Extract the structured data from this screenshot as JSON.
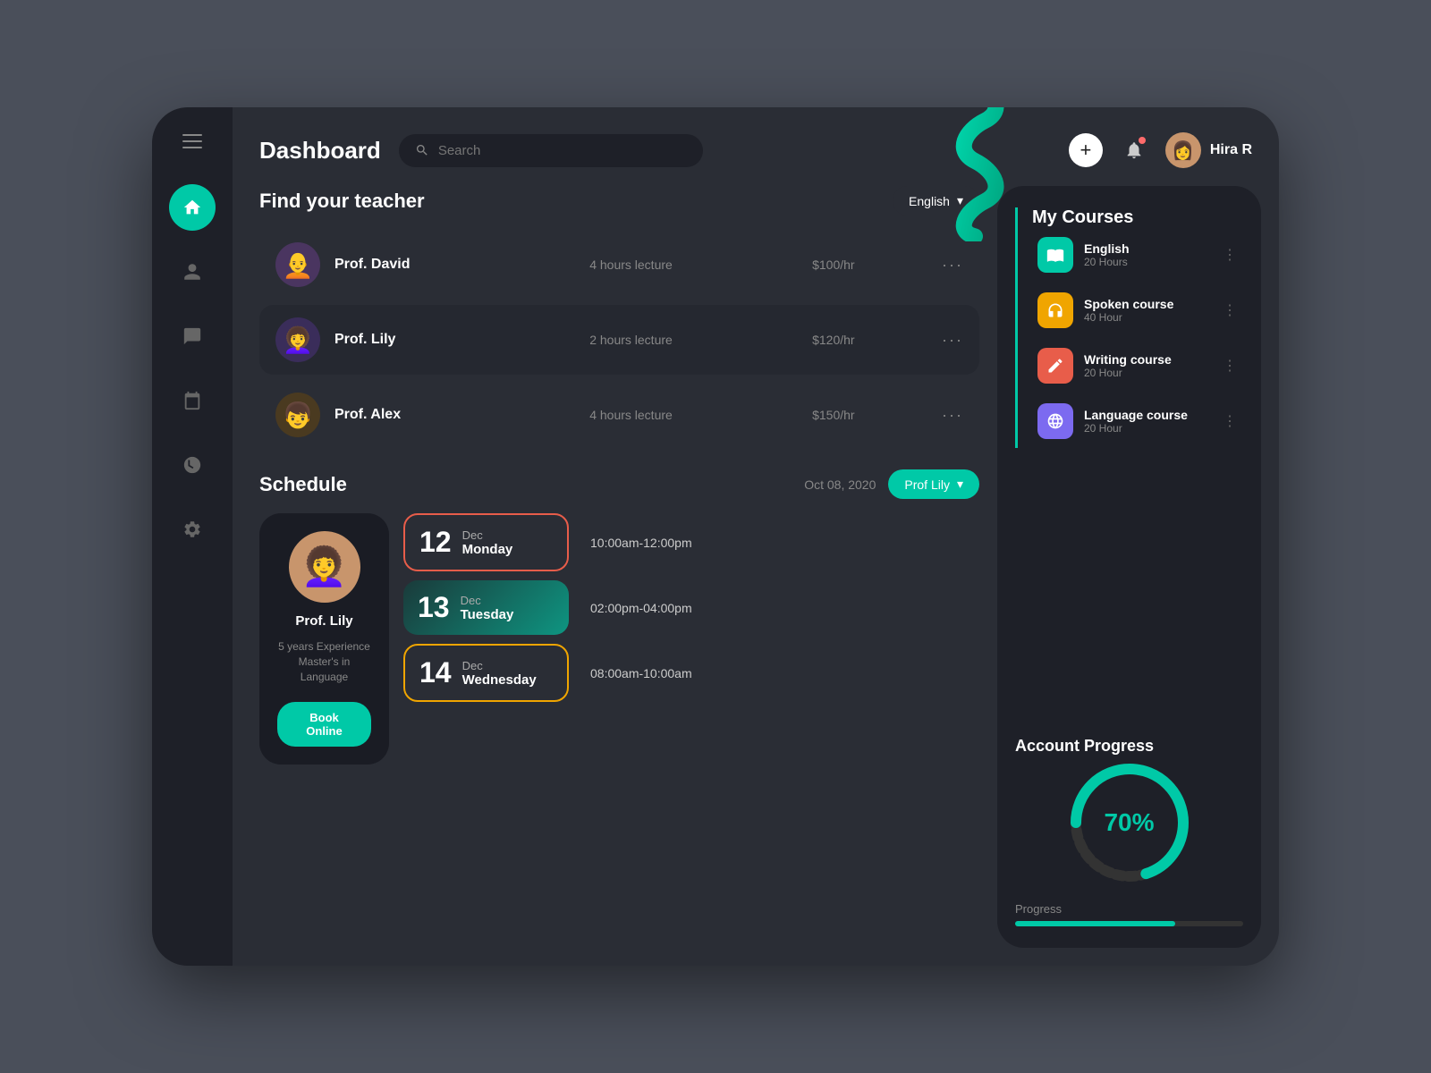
{
  "app": {
    "title": "Dashboard",
    "bg_color": "#4a4f5a"
  },
  "header": {
    "title": "Dashboard",
    "search_placeholder": "Search",
    "add_label": "+",
    "user_name": "Hira R"
  },
  "sidebar": {
    "nav_items": [
      {
        "id": "home",
        "icon": "🏠",
        "active": true
      },
      {
        "id": "user",
        "icon": "👤",
        "active": false
      },
      {
        "id": "chat",
        "icon": "💬",
        "active": false
      },
      {
        "id": "calendar",
        "icon": "📅",
        "active": false
      },
      {
        "id": "clock",
        "icon": "🕐",
        "active": false
      },
      {
        "id": "settings",
        "icon": "⚙️",
        "active": false
      }
    ]
  },
  "find_teacher": {
    "section_title": "Find your teacher",
    "filter_label": "English",
    "teachers": [
      {
        "name": "Prof. David",
        "hours": "4 hours lecture",
        "rate": "$100/hr",
        "emoji": "🧑"
      },
      {
        "name": "Prof. Lily",
        "hours": "2 hours lecture",
        "rate": "$120/hr",
        "emoji": "👩‍🦱",
        "active": true
      },
      {
        "name": "Prof. Alex",
        "hours": "4 hours lecture",
        "rate": "$150/hr",
        "emoji": "👦"
      }
    ]
  },
  "schedule": {
    "section_title": "Schedule",
    "date": "Oct 08, 2020",
    "filter_label": "Prof Lily",
    "prof_card": {
      "name": "Prof. Lily",
      "experience": "5 years Experience",
      "degree": "Master's in Language",
      "emoji": "👩‍🦱",
      "book_label": "Book Online"
    },
    "items": [
      {
        "day_num": "12",
        "month": "Dec",
        "weekday": "Monday",
        "time": "10:00am-12:00pm",
        "style": "red-border"
      },
      {
        "day_num": "13",
        "month": "Dec",
        "weekday": "Tuesday",
        "time": "02:00pm-04:00pm",
        "style": "teal-bg"
      },
      {
        "day_num": "14",
        "month": "Dec",
        "weekday": "Wednesday",
        "time": "08:00am-10:00am",
        "style": "yellow-border"
      }
    ]
  },
  "my_courses": {
    "title": "My Courses",
    "courses": [
      {
        "name": "English",
        "hours": "20 Hours",
        "color": "teal",
        "icon": "📚"
      },
      {
        "name": "Spoken course",
        "hours": "40 Hour",
        "color": "orange",
        "icon": "🎙️"
      },
      {
        "name": "Writing course",
        "hours": "20 Hour",
        "color": "red",
        "icon": "✏️"
      },
      {
        "name": "Language course",
        "hours": "20 Hour",
        "color": "purple",
        "icon": "🌐"
      }
    ]
  },
  "account_progress": {
    "title": "Account Progress",
    "percent": 70,
    "percent_label": "70%",
    "progress_label": "Progress"
  }
}
